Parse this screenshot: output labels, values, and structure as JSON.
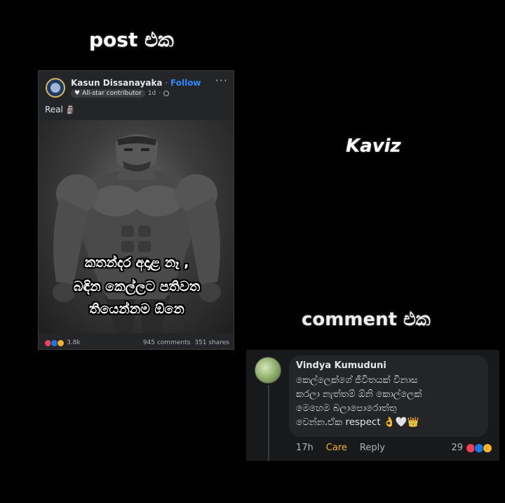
{
  "headings": {
    "post": "post එක",
    "comment": "comment එක",
    "watermark": "Kaviz"
  },
  "post": {
    "author": "Kasun Dissanayaka",
    "separator": "·",
    "follow": "Follow",
    "badge": "All-star contributor",
    "time": "1d",
    "dot": "·",
    "more": "···",
    "caption": "Real",
    "caption_emoji": "🗿",
    "image_text": [
      "කතන්දර අදාළ නෑ ,",
      "බඳින කෙල්ලට පතිවත",
      "තියෙන්නම ඕනෙ"
    ],
    "reaction_count": "3.8k",
    "comments": "945 comments",
    "shares": "351 shares"
  },
  "comment": {
    "name": "Vindya Kumuduni",
    "lines": [
      "කෙල්ලෙක්ගේ ජීවිතයක් විනාස",
      "කරලා නැත්තම් ඕනි කොල්ලෙක්",
      "මෙහෙම බලාපොරොත්තු",
      "වෙන්න.ඒක respect 👌🤍👑"
    ],
    "time": "17h",
    "care": "Care",
    "reply": "Reply",
    "reaction_count": "29"
  },
  "colors": {
    "background": "#000000",
    "card": "#242526",
    "link_blue": "#2d88ff",
    "care_yellow": "#f7b125",
    "love_red": "#f33e58",
    "like_blue": "#1877f2"
  }
}
